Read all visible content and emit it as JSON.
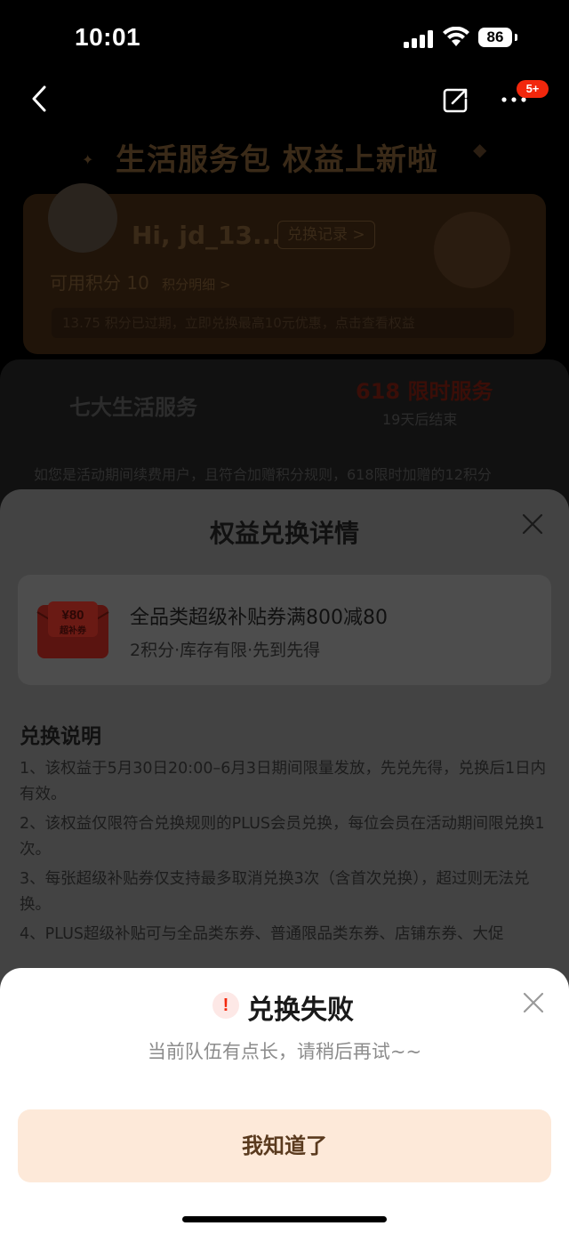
{
  "status_bar": {
    "time": "10:01",
    "battery": "86"
  },
  "nav": {
    "badge": "5+"
  },
  "background_page": {
    "title": "生活服务包 权益上新啦",
    "user_greeting": "Hi, jd_13...",
    "exchange_record": "兑换记录 >",
    "points_label": "可用积分 10",
    "points_detail": "积分明细 >",
    "info_bar": "13.75 积分已过期，立即兑换最高10元优惠，点击查看权益",
    "tab_services": "七大生活服务",
    "tab_618": "618 限时服务",
    "tab_618_sub": "19天后结束",
    "description": "如您是活动期间续费用户，且符合加赠积分规则，618限时加赠的12积分"
  },
  "detail_sheet": {
    "title": "权益兑换详情",
    "product": {
      "name": "全品类超级补贴券满800减80",
      "subtitle": "2积分·库存有限·先到先得",
      "coupon_amount": "¥80",
      "coupon_label": "超补券"
    },
    "rules_heading": "兑换说明",
    "rules": [
      "1、该权益于5月30日20:00–6月3日期间限量发放，先兑先得，兑换后1日内有效。",
      "2、该权益仅限符合兑换规则的PLUS会员兑换，每位会员在活动期间限兑换1次。",
      "3、每张超级补贴券仅支持最多取消兑换3次（含首次兑换），超过则无法兑换。",
      "4、PLUS超级补贴可与全品类东券、普通限品类东券、店铺东券、大促"
    ]
  },
  "modal": {
    "icon": "!",
    "title": "兑换失败",
    "message": "当前队伍有点长，请稍后再试~~",
    "button": "我知道了"
  },
  "colors": {
    "accent": "#f2270c",
    "button_bg": "#fde9d9",
    "button_text": "#5a3a1e"
  }
}
